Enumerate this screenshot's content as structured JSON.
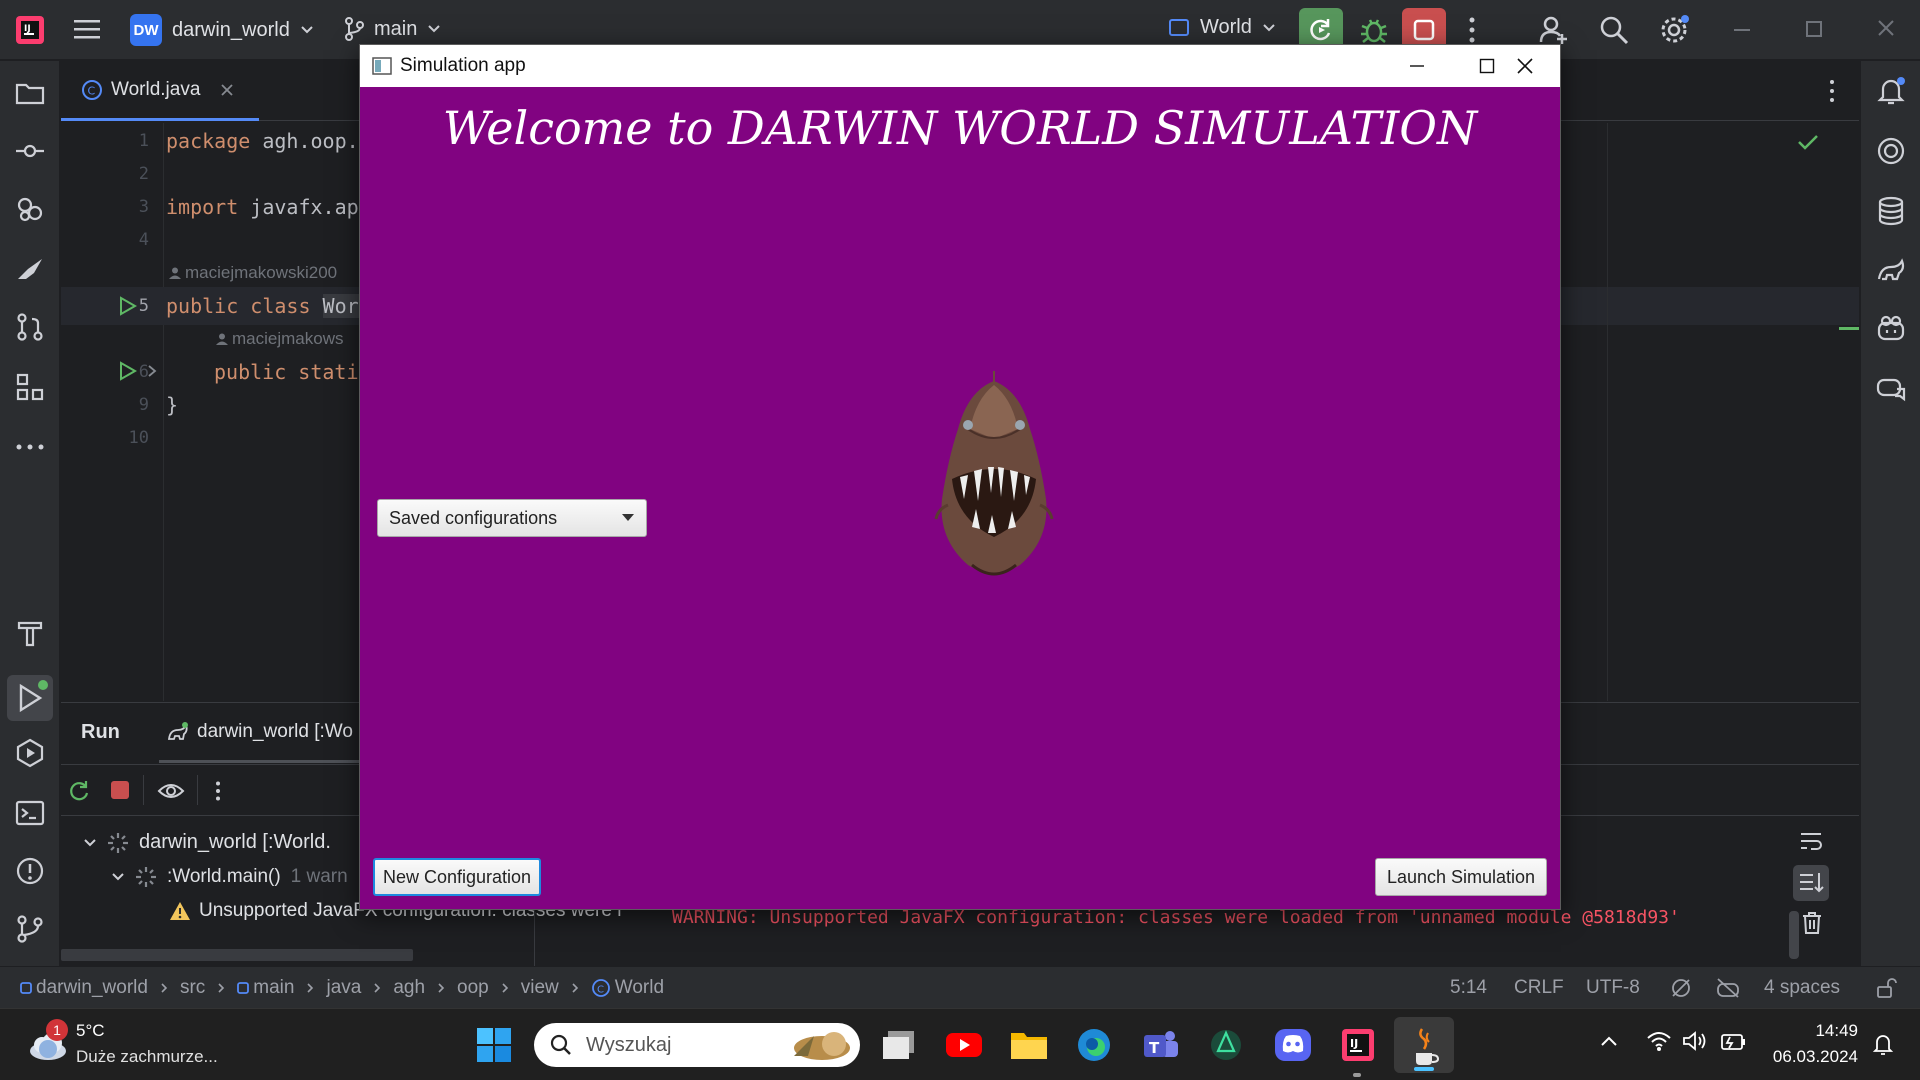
{
  "ide": {
    "project_badge": "DW",
    "project_name": "darwin_world",
    "branch": "main",
    "run_config": "World"
  },
  "editor": {
    "tab_label": "World.java",
    "line_numbers": [
      "1",
      "2",
      "3",
      "4",
      "5",
      "6",
      "9",
      "10"
    ],
    "line1_kw": "package",
    "line1_text": " agh.oop.",
    "line3_kw": "import",
    "line3_text": " javafx.ap",
    "author1": "maciejmakowski200",
    "line5_kw": "public class",
    "line5_text": "Wor",
    "author2": "maciejmakows",
    "line6_kw": "public stati",
    "line9_text": "}"
  },
  "run_panel": {
    "tab_run": "Run",
    "tab_config": "darwin_world [:Wo",
    "tree_root": "darwin_world [:World.",
    "tree_child": ":World.main()",
    "tree_child_suffix": "1 warn",
    "warning_item": "Unsupported JavaFX configuration: classes were l",
    "console_line": "WARNING: Unsupported JavaFX configuration: classes were loaded from 'unnamed module @5818d93'"
  },
  "statusbar": {
    "breadcrumb": [
      "darwin_world",
      "src",
      "main",
      "java",
      "agh",
      "oop",
      "view",
      "World"
    ],
    "position": "5:14",
    "line_sep": "CRLF",
    "encoding": "UTF-8",
    "indent": "4 spaces"
  },
  "simulation_window": {
    "title": "Simulation app",
    "heading": "Welcome to DARWIN WORLD SIMULATION",
    "combo_label": "Saved configurations",
    "new_config_button": "New Configuration",
    "launch_button": "Launch Simulation",
    "background_color": "#810381"
  },
  "taskbar": {
    "weather_temp": "5°C",
    "weather_desc": "Duże zachmurze...",
    "weather_badge": "1",
    "search_placeholder": "Wyszukaj",
    "time": "14:49",
    "date": "06.03.2024"
  }
}
